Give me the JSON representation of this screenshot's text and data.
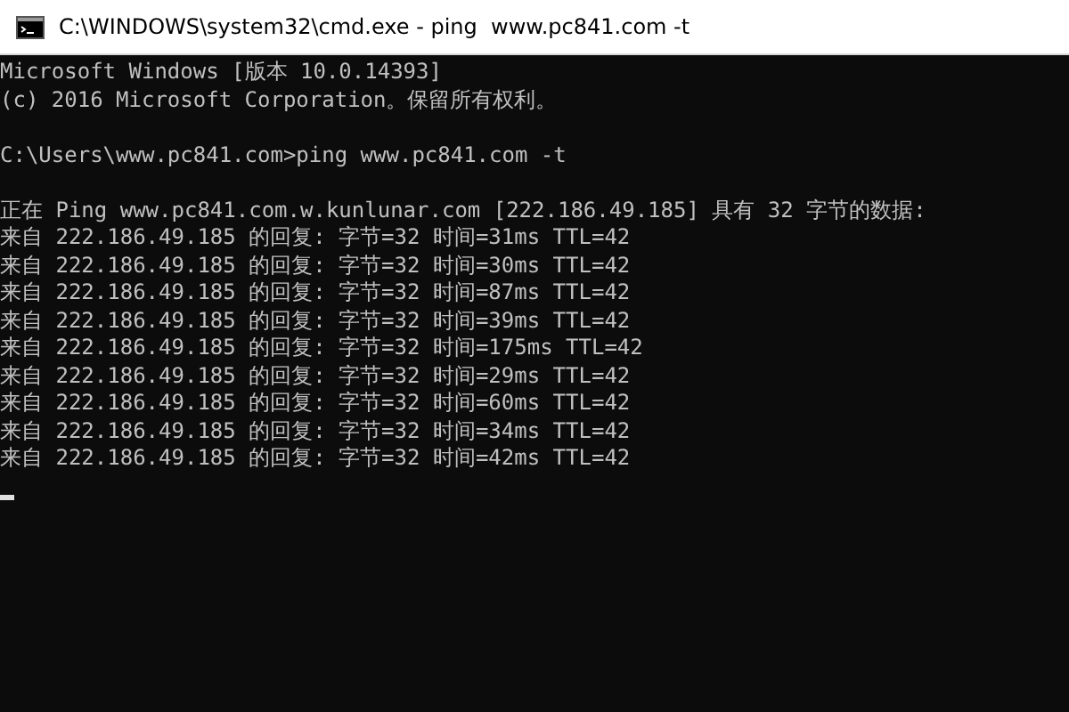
{
  "window": {
    "title": "C:\\WINDOWS\\system32\\cmd.exe - ping  www.pc841.com -t"
  },
  "console": {
    "banner": [
      "Microsoft Windows [版本 10.0.14393]",
      "(c) 2016 Microsoft Corporation。保留所有权利。"
    ],
    "command": "C:\\Users\\www.pc841.com>ping www.pc841.com -t",
    "ping_header": "正在 Ping www.pc841.com.w.kunlunar.com [222.186.49.185] 具有 32 字节的数据:",
    "replies": [
      "来自 222.186.49.185 的回复: 字节=32 时间=31ms TTL=42",
      "来自 222.186.49.185 的回复: 字节=32 时间=30ms TTL=42",
      "来自 222.186.49.185 的回复: 字节=32 时间=87ms TTL=42",
      "来自 222.186.49.185 的回复: 字节=32 时间=39ms TTL=42",
      "来自 222.186.49.185 的回复: 字节=32 时间=175ms TTL=42",
      "来自 222.186.49.185 的回复: 字节=32 时间=29ms TTL=42",
      "来自 222.186.49.185 的回复: 字节=32 时间=60ms TTL=42",
      "来自 222.186.49.185 的回复: 字节=32 时间=34ms TTL=42",
      "来自 222.186.49.185 的回复: 字节=32 时间=42ms TTL=42"
    ]
  }
}
